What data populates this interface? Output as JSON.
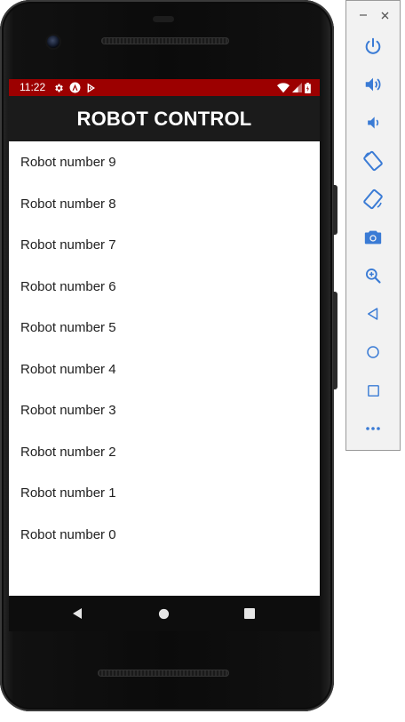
{
  "status_bar": {
    "time": "11:22",
    "background": "#9c0000"
  },
  "app_bar": {
    "title": "ROBOT CONTROL",
    "background": "#1b1b1b"
  },
  "robots": [
    "Robot number 9",
    "Robot number 8",
    "Robot number 7",
    "Robot number 6",
    "Robot number 5",
    "Robot number 4",
    "Robot number 3",
    "Robot number 2",
    "Robot number 1",
    "Robot number 0"
  ],
  "status_icons": [
    "settings-icon",
    "android-auto-icon",
    "play-protect-icon",
    "wifi-icon",
    "cell-signal-icon",
    "battery-icon"
  ],
  "nav_icons": [
    "back-icon",
    "home-icon",
    "recents-icon"
  ],
  "emulator_panel": {
    "window_controls": [
      "minimize-icon",
      "close-icon"
    ],
    "tools": [
      "power-icon",
      "volume-up-icon",
      "volume-down-icon",
      "rotate-left-icon",
      "rotate-right-icon",
      "camera-icon",
      "zoom-icon",
      "back-icon",
      "home-icon",
      "overview-icon",
      "more-icon"
    ],
    "icon_color": "#3a7bd5"
  }
}
